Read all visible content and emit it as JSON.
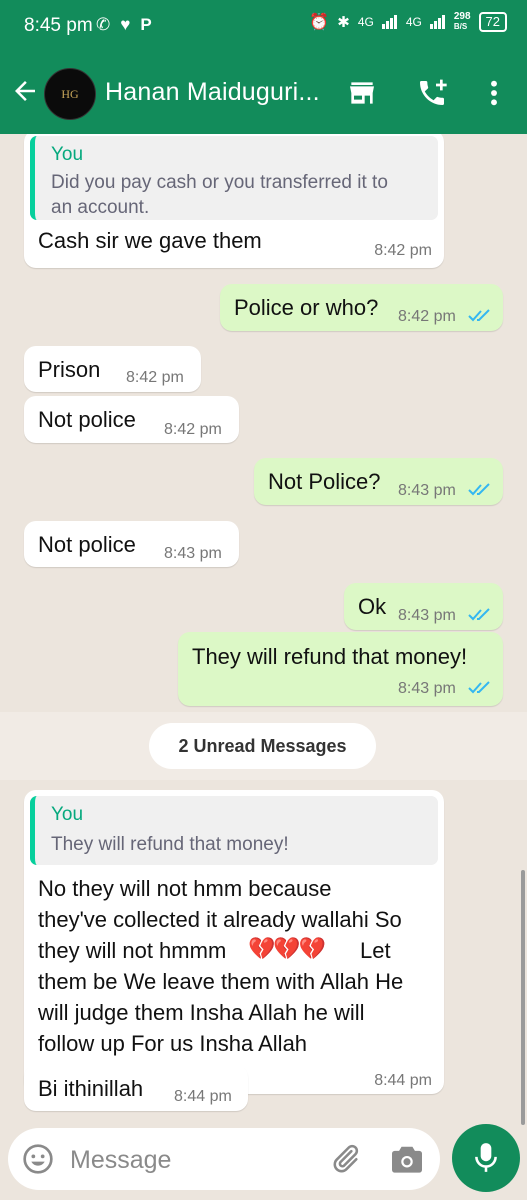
{
  "status_bar": {
    "time": "8:45 pm",
    "net_speed": "298",
    "net_unit": "B/S",
    "battery": "72",
    "net1": "4G",
    "net2": "4G"
  },
  "header": {
    "contact_name": "Hanan Maiduguri...",
    "avatar_text": "HG"
  },
  "messages": [
    {
      "dir": "in",
      "quote_name": "You",
      "quote_text_lines": [
        "Did you pay cash or you transferred it to",
        "an account."
      ],
      "text": "Cash sir we gave  them",
      "time": "8:42 pm"
    },
    {
      "dir": "out",
      "text": "Police or who?",
      "time": "8:42 pm",
      "read": true
    },
    {
      "dir": "in",
      "text": "Prison",
      "time": "8:42 pm"
    },
    {
      "dir": "in",
      "text": "Not police",
      "time": "8:42 pm"
    },
    {
      "dir": "out",
      "text": "Not Police?",
      "time": "8:43 pm",
      "read": true
    },
    {
      "dir": "in",
      "text": "Not police",
      "time": "8:43 pm"
    },
    {
      "dir": "out",
      "text": "Ok",
      "time": "8:43 pm",
      "read": true
    },
    {
      "dir": "out",
      "text": "They will refund that money!",
      "time": "8:43 pm",
      "read": true
    },
    {
      "dir": "in",
      "quote_name": "You",
      "quote_text": "They will refund that money!",
      "text_lines": [
        "No they will not hmm because",
        "they've collected it already wallahi So",
        "they will not hmmm",
        "Let",
        "them be We leave them with Allah He",
        "will judge them Insha Allah he will",
        "follow up For us Insha Allah"
      ],
      "time": "8:44 pm"
    },
    {
      "dir": "in",
      "text": "Bi ithinillah",
      "time": "8:44 pm"
    }
  ],
  "unread_label": "2 Unread Messages",
  "composer": {
    "placeholder": "Message"
  },
  "colors": {
    "header": "#128c5b",
    "outgoing": "#dcf8c6",
    "incoming": "#ffffff",
    "read_ticks": "#34b7f1",
    "quote_bar": "#06cf9c"
  },
  "icons": [
    "back-arrow-icon",
    "store-icon",
    "add-call-icon",
    "more-vert-icon",
    "emoji-icon",
    "attach-icon",
    "camera-icon",
    "mic-icon",
    "broken-heart-icon"
  ]
}
